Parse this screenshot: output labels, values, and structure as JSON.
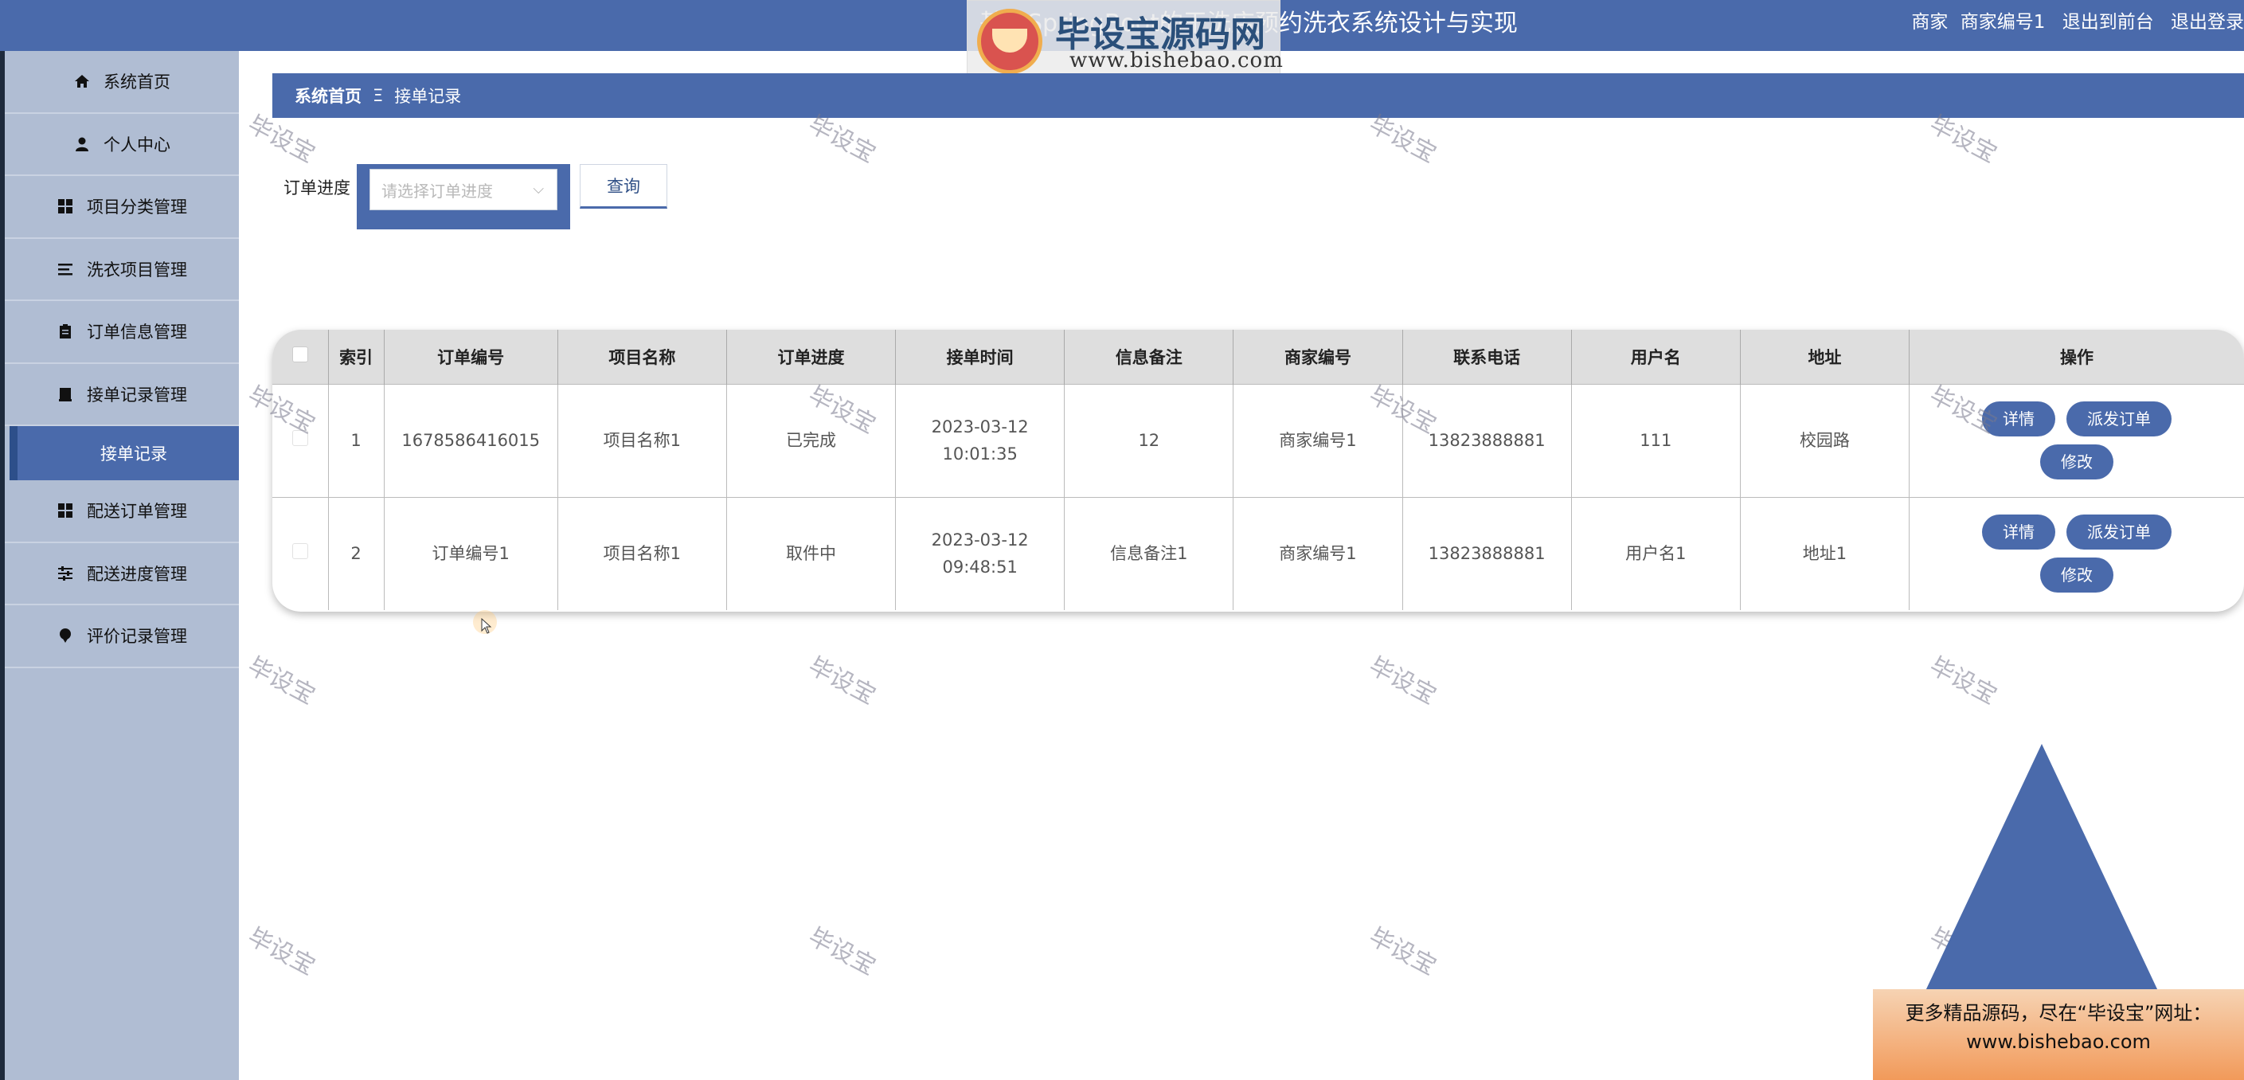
{
  "header": {
    "title": "基于SpringBoot的干洗店预约洗衣系统设计与实现",
    "role": "商家",
    "username": "商家编号1",
    "back_to_front": "退出到前台",
    "logout": "退出登录"
  },
  "logo_overlay": {
    "brand": "毕设宝源码网",
    "url": "www.bishebao.com"
  },
  "sidebar": {
    "items": [
      {
        "label": "系统首页",
        "icon": "home-icon"
      },
      {
        "label": "个人中心",
        "icon": "user-icon"
      },
      {
        "label": "项目分类管理",
        "icon": "grid-icon"
      },
      {
        "label": "洗衣项目管理",
        "icon": "list-icon"
      },
      {
        "label": "订单信息管理",
        "icon": "clipboard-icon"
      },
      {
        "label": "接单记录管理",
        "icon": "box-icon"
      },
      {
        "label": "配送订单管理",
        "icon": "grid-icon"
      },
      {
        "label": "配送进度管理",
        "icon": "sliders-icon"
      },
      {
        "label": "评价记录管理",
        "icon": "pin-icon"
      }
    ],
    "sub_item_active": "接单记录"
  },
  "breadcrumb": {
    "home": "系统首页",
    "separator": "Ξ",
    "current": "接单记录"
  },
  "search": {
    "label": "订单进度",
    "placeholder": "请选择订单进度",
    "button": "查询"
  },
  "table": {
    "headers": [
      "索引",
      "订单编号",
      "项目名称",
      "订单进度",
      "接单时间",
      "信息备注",
      "商家编号",
      "联系电话",
      "用户名",
      "地址",
      "操作"
    ],
    "rows": [
      {
        "index": "1",
        "order_no": "1678586416015",
        "project_name": "项目名称1",
        "progress": "已完成",
        "time": "2023-03-12 10:01:35",
        "remark": "12",
        "merchant_no": "商家编号1",
        "phone": "13823888881",
        "username": "111",
        "address": "校园路"
      },
      {
        "index": "2",
        "order_no": "订单编号1",
        "project_name": "项目名称1",
        "progress": "取件中",
        "time": "2023-03-12 09:48:51",
        "remark": "信息备注1",
        "merchant_no": "商家编号1",
        "phone": "13823888881",
        "username": "用户名1",
        "address": "地址1"
      }
    ],
    "actions": {
      "detail": "详情",
      "dispatch": "派发订单",
      "edit": "修改"
    }
  },
  "watermark": "毕设宝",
  "ad_banner": {
    "line1": "更多精品源码，尽在“毕设宝”网址：",
    "line2": "www.bishebao.com"
  },
  "colors": {
    "primary": "#4a6aab",
    "sidebar_bg": "#b0bdd3",
    "table_header_bg": "#dedede"
  }
}
